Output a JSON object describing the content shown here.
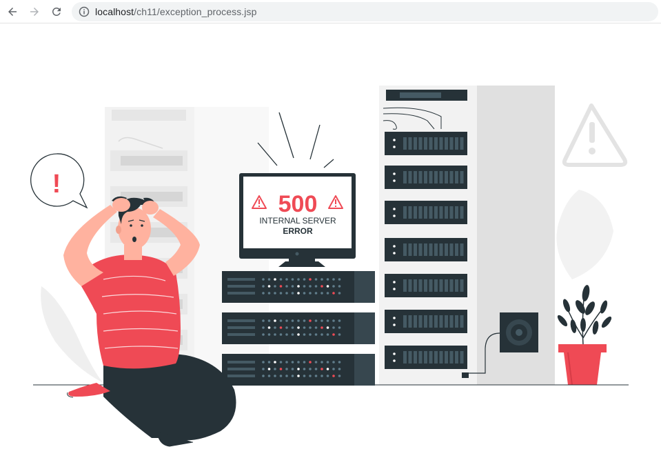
{
  "browser": {
    "url_host": "localhost",
    "url_path": "/ch11/exception_process.jsp",
    "icons": {
      "back": "arrow-left-icon",
      "forward": "arrow-right-icon",
      "reload": "reload-icon",
      "site_info": "info-icon"
    }
  },
  "illustration": {
    "error_code": "500",
    "error_line1": "INTERNAL SERVER",
    "error_line2": "ERROR",
    "speech_mark": "!",
    "colors": {
      "accent": "#ef4a55",
      "dark": "#263238",
      "light_gray": "#ebebeb",
      "mid_gray": "#e0e0e0"
    }
  }
}
